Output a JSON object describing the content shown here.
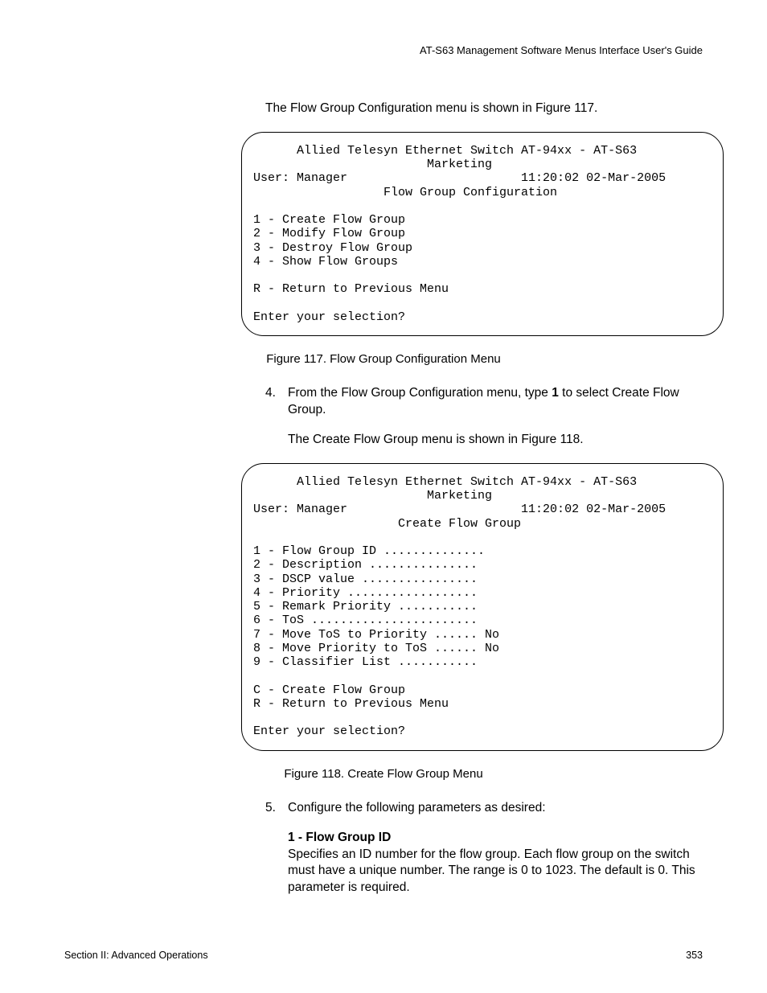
{
  "header": {
    "running_head": "AT-S63 Management Software Menus Interface User's Guide"
  },
  "p1": "The Flow Group Configuration menu is shown in Figure 117.",
  "menu1": "      Allied Telesyn Ethernet Switch AT-94xx - AT-S63\n                        Marketing\nUser: Manager                        11:20:02 02-Mar-2005\n                  Flow Group Configuration\n\n1 - Create Flow Group\n2 - Modify Flow Group\n3 - Destroy Flow Group\n4 - Show Flow Groups\n\nR - Return to Previous Menu\n\nEnter your selection?",
  "caption1": "Figure 117. Flow Group Configuration Menu",
  "step4": {
    "num": "4.",
    "text_a": "From the Flow Group Configuration menu, type ",
    "bold": "1",
    "text_b": " to select Create Flow Group."
  },
  "p2": "The Create Flow Group menu is shown in Figure 118.",
  "menu2": "      Allied Telesyn Ethernet Switch AT-94xx - AT-S63\n                        Marketing\nUser: Manager                        11:20:02 02-Mar-2005\n                    Create Flow Group\n\n1 - Flow Group ID ..............\n2 - Description ...............\n3 - DSCP value ................\n4 - Priority ..................\n5 - Remark Priority ...........\n6 - ToS .......................\n7 - Move ToS to Priority ...... No\n8 - Move Priority to ToS ...... No\n9 - Classifier List ...........\n\nC - Create Flow Group\nR - Return to Previous Menu\n\nEnter your selection?",
  "caption2": "Figure 118. Create Flow Group Menu",
  "step5": {
    "num": "5.",
    "text": "Configure the following parameters as desired:"
  },
  "param1": {
    "title": "1 - Flow Group ID",
    "body": "Specifies an ID number for the flow group. Each flow group on the switch must have a unique number. The range is 0 to 1023. The default is 0. This parameter is required."
  },
  "footer": {
    "left": "Section II: Advanced Operations",
    "right": "353"
  }
}
